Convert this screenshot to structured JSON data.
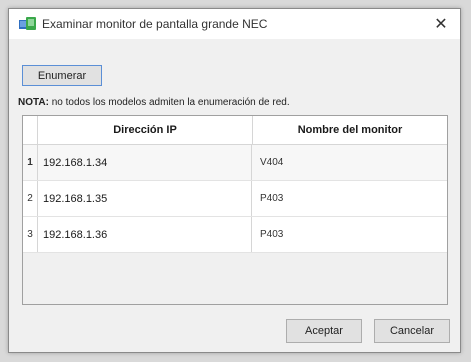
{
  "window": {
    "title": "Examinar monitor de pantalla grande NEC",
    "close_glyph": "✕"
  },
  "toolbar": {
    "enumerate_label": "Enumerar"
  },
  "note": {
    "prefix": "NOTA:",
    "text": " no todos los modelos admiten la enumeración de red."
  },
  "table": {
    "columns": [
      "Dirección IP",
      "Nombre del monitor"
    ],
    "rows": [
      {
        "num": "1",
        "ip": "192.168.1.34",
        "name": "V404",
        "selected": true
      },
      {
        "num": "2",
        "ip": "192.168.1.35",
        "name": "P403",
        "selected": false
      },
      {
        "num": "3",
        "ip": "192.168.1.36",
        "name": "P403",
        "selected": false
      }
    ]
  },
  "footer": {
    "accept_label": "Aceptar",
    "cancel_label": "Cancelar"
  },
  "icons": {
    "app": "monitor-icon",
    "close": "close-icon"
  },
  "colors": {
    "accent_border": "#5b8fd6",
    "icon_blue": "#2f6fc1",
    "icon_green": "#3aa84a"
  }
}
